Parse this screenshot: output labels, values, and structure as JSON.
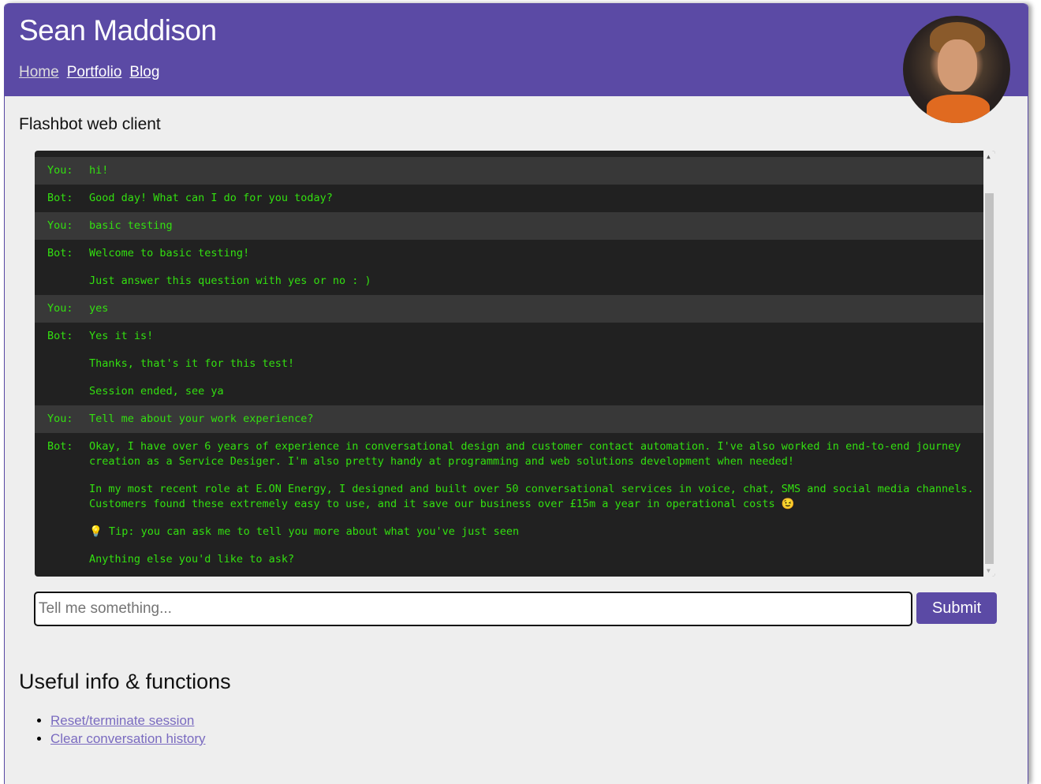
{
  "header": {
    "title": "Sean Maddison",
    "nav": [
      {
        "label": "Home"
      },
      {
        "label": "Portfolio"
      },
      {
        "label": "Blog"
      }
    ],
    "avatar": "profile-photo"
  },
  "section_title": "Flashbot web client",
  "chat": {
    "messages": [
      {
        "who": "You:",
        "lines": [
          "hi!"
        ]
      },
      {
        "who": "Bot:",
        "lines": [
          "Good day! What can I do for you today?"
        ]
      },
      {
        "who": "You:",
        "lines": [
          "basic testing"
        ]
      },
      {
        "who": "Bot:",
        "lines": [
          "Welcome to basic testing!",
          "Just answer this question with yes or no : )"
        ]
      },
      {
        "who": "You:",
        "lines": [
          "yes"
        ]
      },
      {
        "who": "Bot:",
        "lines": [
          "Yes it is!",
          "Thanks, that's it for this test!",
          "Session ended, see ya"
        ]
      },
      {
        "who": "You:",
        "lines": [
          "Tell me about your work experience?"
        ]
      },
      {
        "who": "Bot:",
        "lines": [
          "Okay, I have over 6 years of experience in conversational design and customer contact automation. I've also worked in end-to-end journey creation as a Service Desiger. I'm also pretty handy at programming and web solutions development when needed!",
          "In my most recent role at E.ON Energy, I designed and built over 50 conversational services in voice, chat, SMS and social media channels. Customers found these extremely easy to use, and it save our business over £15m a year in operational costs 😉",
          "💡 Tip: you can ask me to tell you more about what you've just seen",
          "Anything else you'd like to ask?"
        ]
      }
    ],
    "colors": {
      "text": "#33e010",
      "bg": "#212121",
      "you_bg": "#383838"
    }
  },
  "input": {
    "placeholder": "Tell me something...",
    "value": ""
  },
  "submit_label": "Submit",
  "useful": {
    "title": "Useful info & functions",
    "links": [
      {
        "label": "Reset/terminate session"
      },
      {
        "label": "Clear conversation history"
      }
    ]
  },
  "colors": {
    "brand": "#5b4aa5",
    "page_bg": "#eeeeee"
  }
}
